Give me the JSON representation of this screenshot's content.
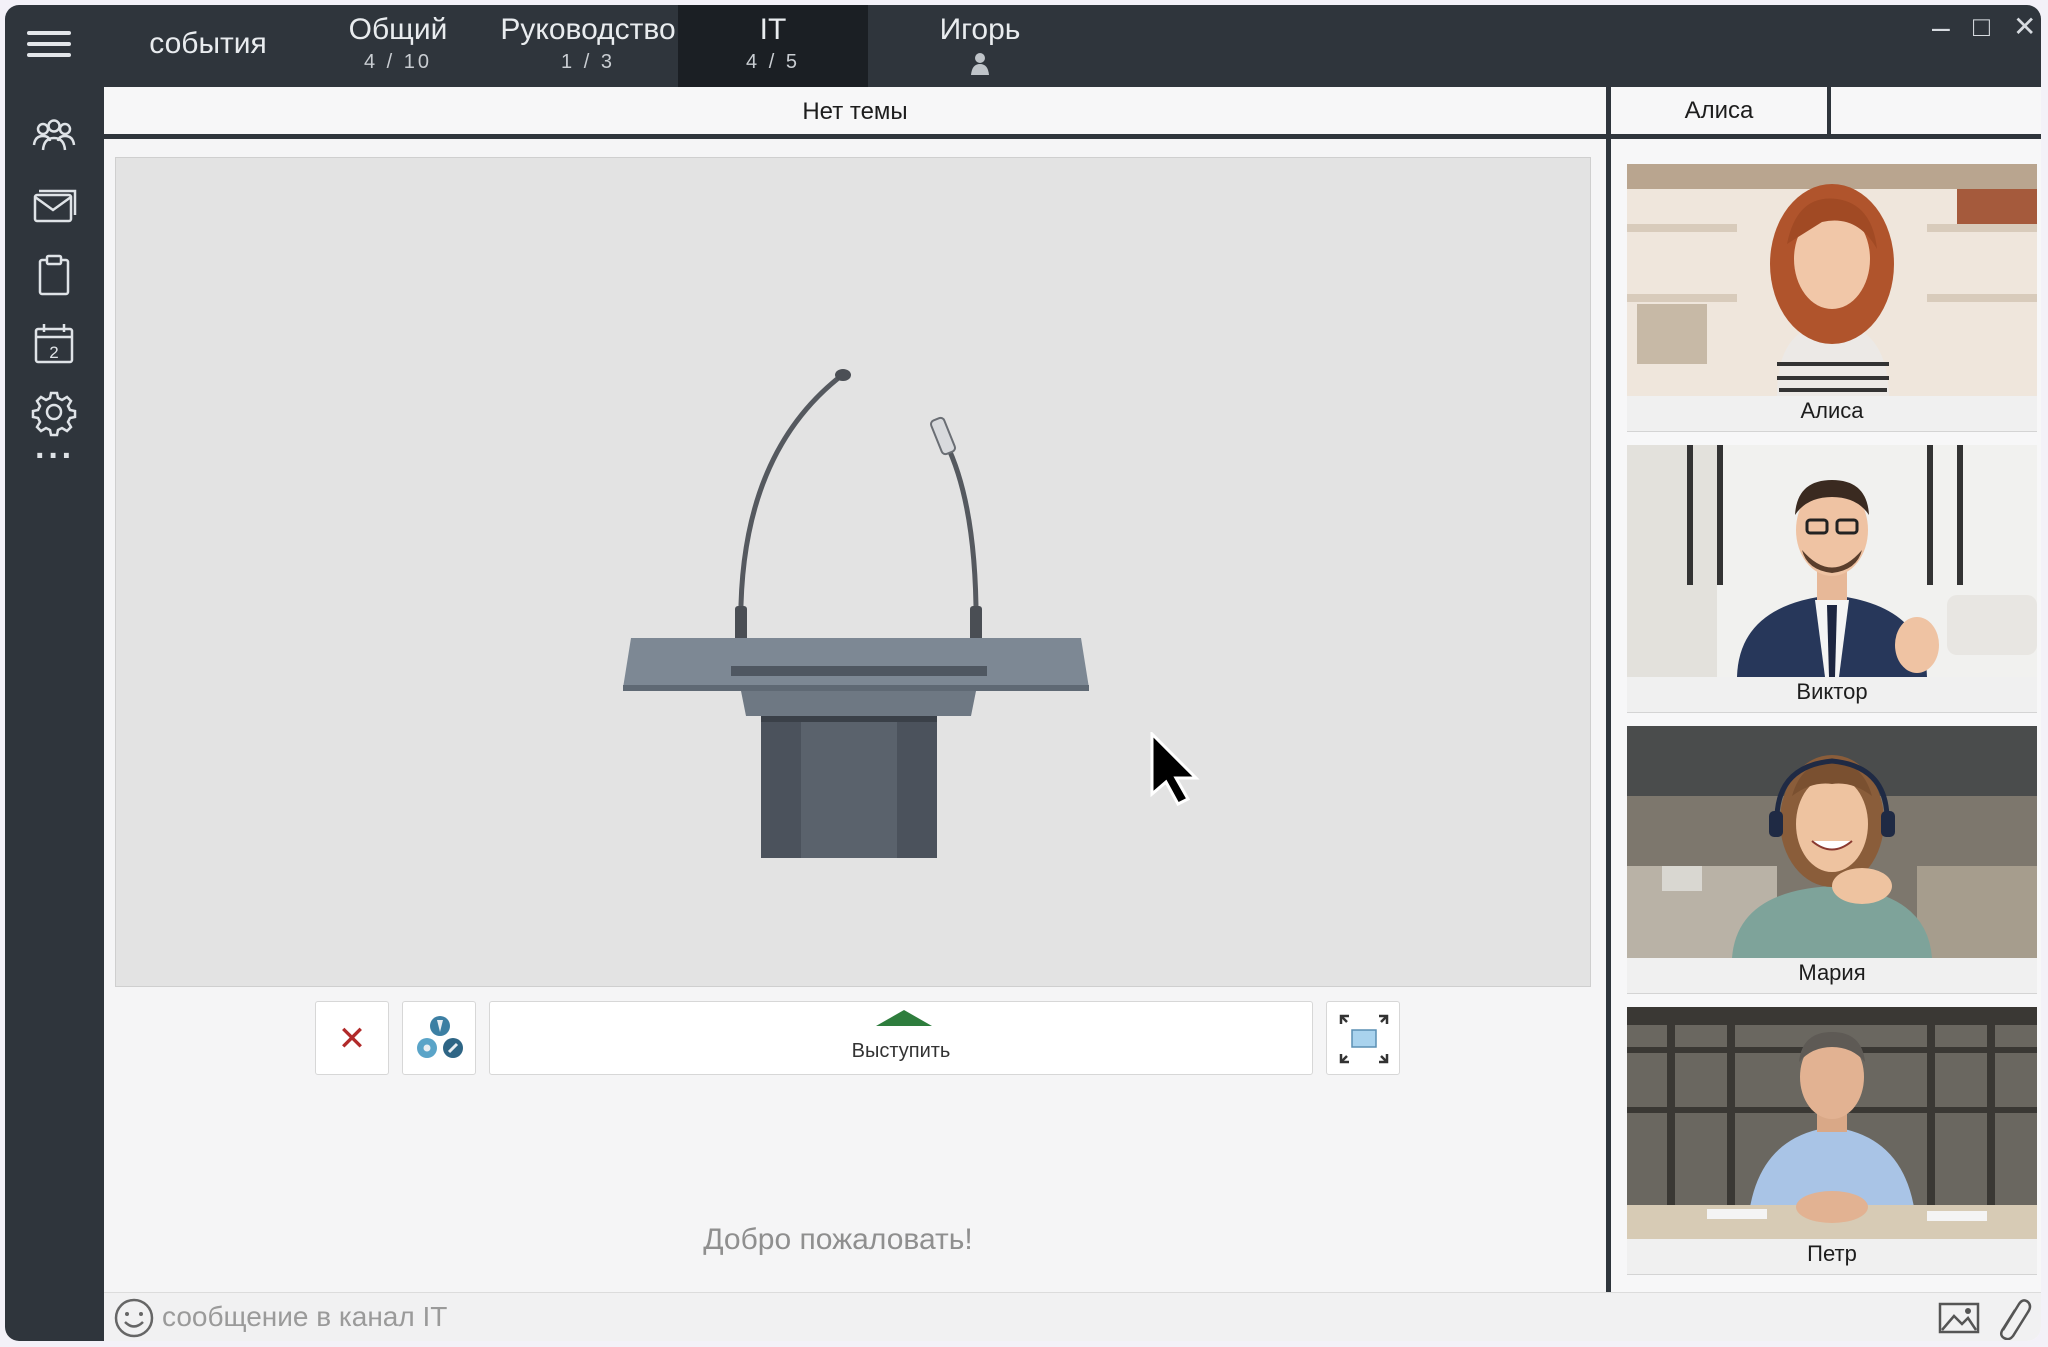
{
  "topbar": {
    "tabs": [
      {
        "name": "события",
        "count": ""
      },
      {
        "name": "Общий",
        "count": "4 / 10"
      },
      {
        "name": "Руководство",
        "count": "1 / 3"
      },
      {
        "name": "IT",
        "count": "4 / 5"
      },
      {
        "name": "Игорь",
        "count": ""
      }
    ],
    "window_controls": {
      "minimize": "–",
      "maximize": "□",
      "close": "✕"
    }
  },
  "left_rail": {
    "icons": [
      "menu-icon",
      "users-icon",
      "mail-icon",
      "clipboard-icon",
      "calendar-icon",
      "gear-icon",
      "more-icon"
    ],
    "calendar_day": "2",
    "more": "···"
  },
  "main": {
    "topic": "Нет темы",
    "speak_label": "Выступить",
    "welcome": "Добро пожаловать!"
  },
  "right_panel": {
    "active_tab": "Алиса",
    "participants": [
      {
        "name": "Алиса"
      },
      {
        "name": "Виктор"
      },
      {
        "name": "Мария"
      },
      {
        "name": "Петр"
      }
    ]
  },
  "input": {
    "placeholder": "сообщение в канал IT"
  },
  "colors": {
    "chrome_dark": "#2f353c",
    "active_tab": "#1b1f24",
    "speak_arrow": "#2e7d3d",
    "close_x": "#b12a2a"
  }
}
